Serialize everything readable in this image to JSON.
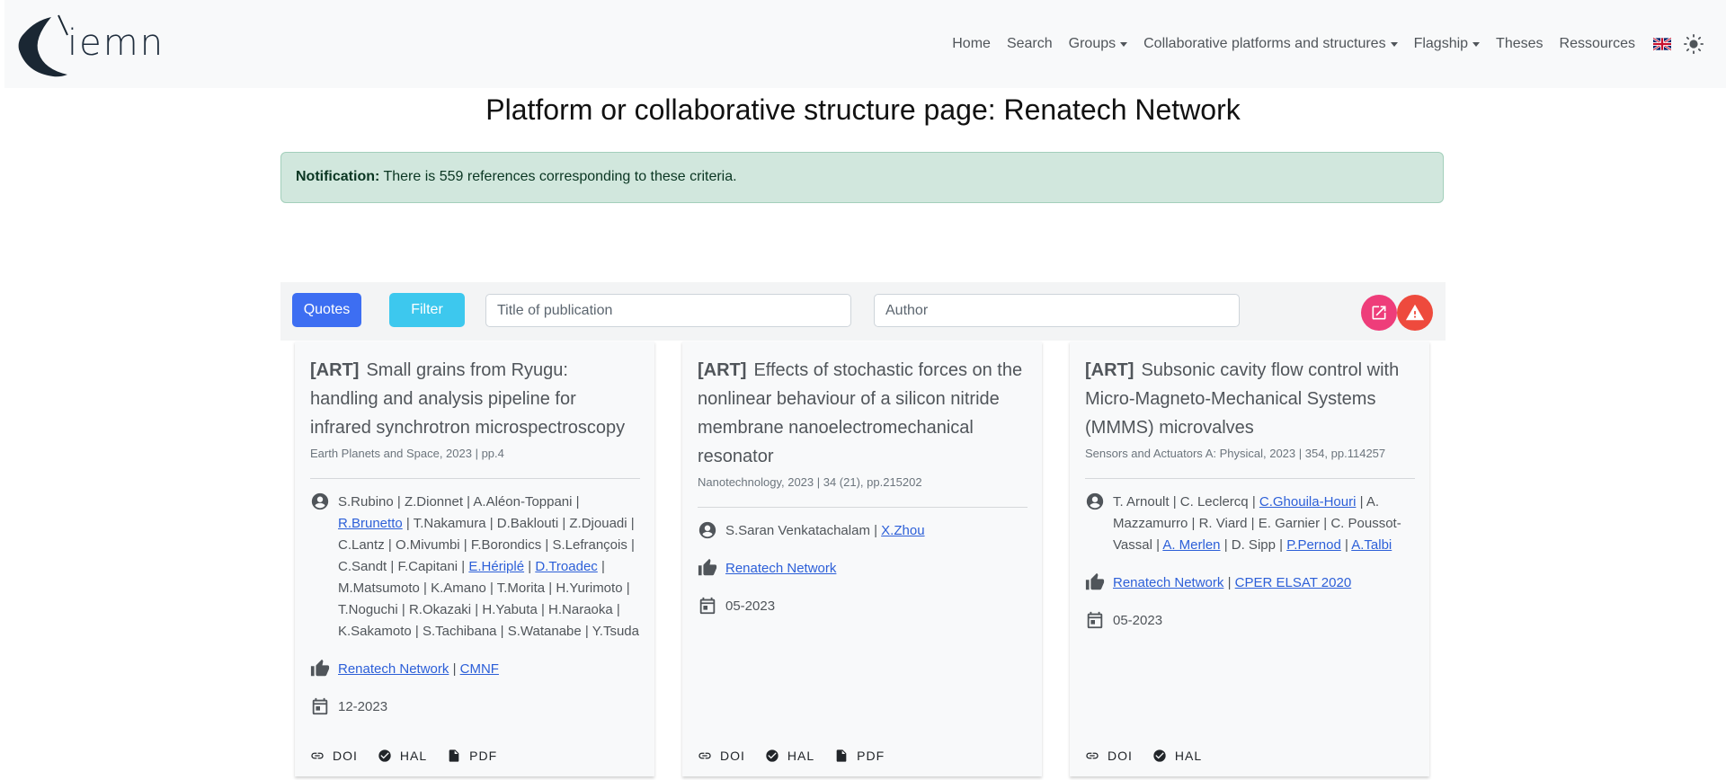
{
  "brand": {
    "logo_text": "iemn"
  },
  "nav": {
    "home": "Home",
    "search": "Search",
    "groups": "Groups",
    "collab": "Collaborative platforms and structures",
    "flagship": "Flagship",
    "theses": "Theses",
    "ressources": "Ressources"
  },
  "page": {
    "title": "Platform or collaborative structure page: Renatech Network"
  },
  "notification": {
    "label": "Notification:",
    "text": "There is 559 references corresponding to these criteria."
  },
  "toolbar": {
    "quotes_label": "Quotes",
    "filter_label": "Filter",
    "title_placeholder": "Title of publication",
    "author_placeholder": "Author"
  },
  "cards": [
    {
      "type": "[ART]",
      "title": "Small grains from Ryugu: handling and analysis pipeline for infrared synchrotron microspectroscopy",
      "journal": "Earth Planets and Space, 2023 | pp.4",
      "authors": [
        {
          "text": "S.Rubino",
          "link": false
        },
        {
          "text": "Z.Dionnet",
          "link": false
        },
        {
          "text": "A.Aléon-Toppani",
          "link": false
        },
        {
          "text": "R.Brunetto",
          "link": true
        },
        {
          "text": "T.Nakamura",
          "link": false
        },
        {
          "text": "D.Baklouti",
          "link": false
        },
        {
          "text": "Z.Djouadi",
          "link": false
        },
        {
          "text": "C.Lantz",
          "link": false
        },
        {
          "text": "O.Mivumbi",
          "link": false
        },
        {
          "text": "F.Borondics",
          "link": false
        },
        {
          "text": "S.Lefrançois",
          "link": false
        },
        {
          "text": "C.Sandt",
          "link": false
        },
        {
          "text": "F.Capitani",
          "link": false
        },
        {
          "text": "E.Hériplé",
          "link": true
        },
        {
          "text": "D.Troadec",
          "link": true
        },
        {
          "text": "M.Matsumoto",
          "link": false
        },
        {
          "text": "K.Amano",
          "link": false
        },
        {
          "text": "T.Morita",
          "link": false
        },
        {
          "text": "H.Yurimoto",
          "link": false
        },
        {
          "text": "T.Noguchi",
          "link": false
        },
        {
          "text": "R.Okazaki",
          "link": false
        },
        {
          "text": "H.Yabuta",
          "link": false
        },
        {
          "text": "H.Naraoka",
          "link": false
        },
        {
          "text": "K.Sakamoto",
          "link": false
        },
        {
          "text": "S.Tachibana",
          "link": false
        },
        {
          "text": "S.Watanabe",
          "link": false
        },
        {
          "text": "Y.Tsuda",
          "link": false
        }
      ],
      "structures": [
        "Renatech Network",
        "CMNF"
      ],
      "date": "12-2023",
      "footer": [
        "DOI",
        "HAL",
        "PDF"
      ]
    },
    {
      "type": "[ART]",
      "title": "Effects of stochastic forces on the nonlinear behaviour of a silicon nitride membrane nanoelectromechanical resonator",
      "journal": "Nanotechnology, 2023 | 34 (21), pp.215202",
      "authors": [
        {
          "text": "S.Saran Venkatachalam",
          "link": false
        },
        {
          "text": "X.Zhou",
          "link": true
        }
      ],
      "structures": [
        "Renatech Network"
      ],
      "date": "05-2023",
      "footer": [
        "DOI",
        "HAL",
        "PDF"
      ]
    },
    {
      "type": "[ART]",
      "title": "Subsonic cavity flow control with Micro-Magneto-Mechanical Systems (MMMS) microvalves",
      "journal": "Sensors and Actuators A: Physical, 2023 | 354, pp.114257",
      "authors": [
        {
          "text": "T. Arnoult",
          "link": false
        },
        {
          "text": "C. Leclercq",
          "link": false
        },
        {
          "text": "C.Ghouila-Houri",
          "link": true
        },
        {
          "text": "A. Mazzamurro",
          "link": false
        },
        {
          "text": "R. Viard",
          "link": false
        },
        {
          "text": "E. Garnier",
          "link": false
        },
        {
          "text": "C. Poussot-Vassal",
          "link": false
        },
        {
          "text": "A. Merlen",
          "link": true
        },
        {
          "text": "D. Sipp",
          "link": false
        },
        {
          "text": "P.Pernod",
          "link": true
        },
        {
          "text": "A.Talbi",
          "link": true
        }
      ],
      "structures": [
        "Renatech Network",
        "CPER ELSAT 2020"
      ],
      "date": "05-2023",
      "footer": [
        "DOI",
        "HAL"
      ]
    }
  ],
  "colors": {
    "primary": "#3d6ef2",
    "info": "#3dc8ee",
    "pink": "#ee3d7a",
    "danger": "#ee4a3d",
    "success_bg": "#d1e7dd",
    "link": "#2c5fd8"
  },
  "icons": {
    "author": "user-circle-icon",
    "structures": "thumbs-up-icon",
    "date": "calendar-icon",
    "doi": "link-icon",
    "hal": "check-circle-icon",
    "pdf": "file-icon",
    "export": "external-link-icon",
    "report": "warning-icon",
    "lang": "uk-flag-icon",
    "theme": "sun-icon"
  }
}
